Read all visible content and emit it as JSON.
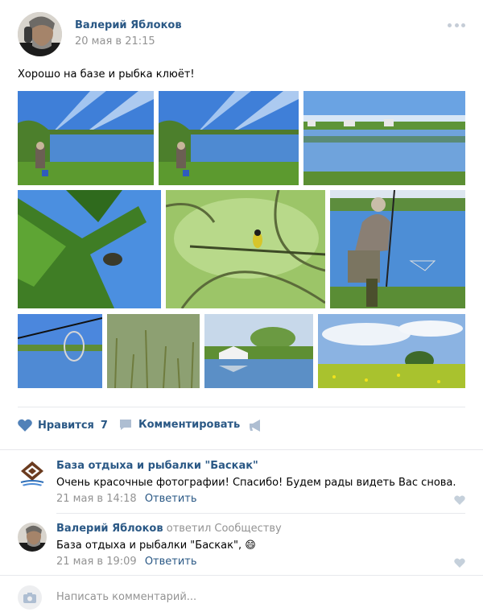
{
  "post": {
    "author": "Валерий Яблоков",
    "date": "20 мая в 21:15",
    "text": "Хорошо на базе и рыбка клюёт!",
    "photos": [
      {
        "name": "photo-fisherman-lake-1",
        "kind": "lake-fisher"
      },
      {
        "name": "photo-fisherman-lake-2",
        "kind": "lake-fisher"
      },
      {
        "name": "photo-pond-reflection",
        "kind": "pond"
      },
      {
        "name": "photo-pine-branch",
        "kind": "pine"
      },
      {
        "name": "photo-bird-on-branch",
        "kind": "bird"
      },
      {
        "name": "photo-man-with-rod",
        "kind": "man-rod"
      },
      {
        "name": "photo-fishing-net",
        "kind": "net"
      },
      {
        "name": "photo-water-reeds",
        "kind": "reeds"
      },
      {
        "name": "photo-yurt-reflection",
        "kind": "yurt"
      },
      {
        "name": "photo-dandelion-meadow",
        "kind": "meadow"
      }
    ]
  },
  "actions": {
    "like_label": "Нравится",
    "like_count": "7",
    "comment_label": "Комментировать"
  },
  "comments": [
    {
      "author": "База отдыха и рыбалки \"Баскак\"",
      "replied": "",
      "text": "Очень красочные фотографии! Спасибо! Будем рады видеть Вас снова.",
      "date": "21 мая в 14:18",
      "reply_label": "Ответить"
    },
    {
      "author": "Валерий Яблоков",
      "replied": "ответил Сообществу",
      "text": "База отдыха и рыбалки \"Баскак\",",
      "emoji": "😄",
      "date": "21 мая в 19:09",
      "reply_label": "Ответить"
    }
  ],
  "composer": {
    "placeholder": "Написать комментарий..."
  },
  "colors": {
    "link": "#2a5885",
    "muted": "#939393",
    "icon": "#5181b8"
  }
}
